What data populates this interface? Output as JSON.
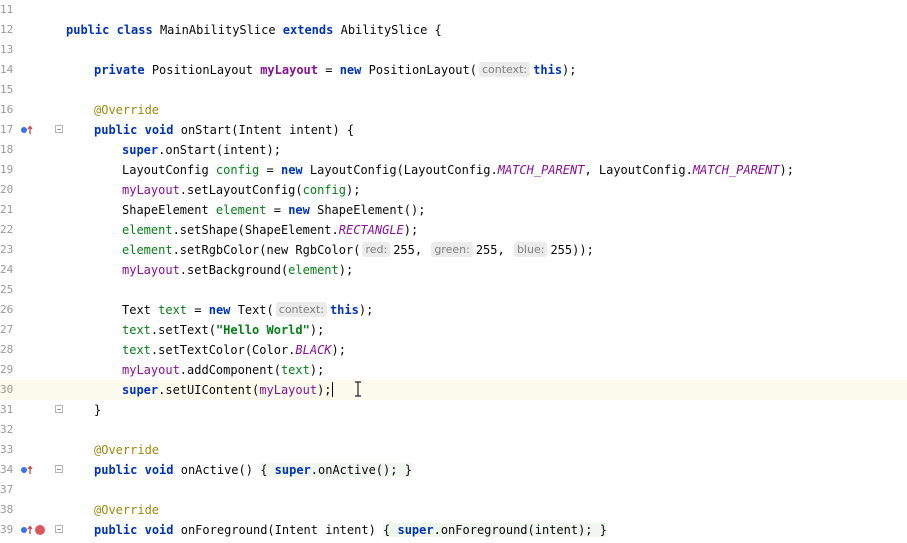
{
  "editor": {
    "lines": {
      "l11": {
        "num": "11"
      },
      "l12": {
        "num": "12",
        "kw_public": "public",
        "kw_class": "class",
        "class_name": "MainAbilitySlice",
        "kw_extends": "extends",
        "super_class": "AbilitySlice {"
      },
      "l13": {
        "num": "13"
      },
      "l14": {
        "num": "14",
        "kw_private": "private",
        "type": "PositionLayout",
        "field": "myLayout",
        "eq": " = ",
        "kw_new": "new",
        "ctor": " PositionLayout(",
        "hint": "context:",
        "kw_this": "this",
        "end": ");"
      },
      "l15": {
        "num": "15"
      },
      "l16": {
        "num": "16",
        "annotation": "@Override"
      },
      "l17": {
        "num": "17",
        "kw_public": "public",
        "kw_void": "void",
        "sig": " onStart(Intent ",
        "param": "intent",
        "end": ") {"
      },
      "l18": {
        "num": "18",
        "kw_super": "super",
        "call": ".onStart(",
        "param": "intent",
        "end": ");"
      },
      "l19": {
        "num": "19",
        "type": "LayoutConfig ",
        "var": "config",
        "eq": " = ",
        "kw_new": "new",
        "ctor": " LayoutConfig(LayoutConfig.",
        "const1": "MATCH_PARENT",
        "mid": ", LayoutConfig.",
        "const2": "MATCH_PARENT",
        "end": ");"
      },
      "l20": {
        "num": "20",
        "field": "myLayout",
        "call": ".setLayoutConfig(",
        "var": "config",
        "end": ");"
      },
      "l21": {
        "num": "21",
        "type": "ShapeElement ",
        "var": "element",
        "eq": " = ",
        "kw_new": "new",
        "ctor": " ShapeElement();"
      },
      "l22": {
        "num": "22",
        "var": "element",
        "call": ".setShape(ShapeElement.",
        "const": "RECTANGLE",
        "end": ");"
      },
      "l23": {
        "num": "23",
        "var": "element",
        "call": ".setRgbColor(",
        "kw_new": "new",
        "ctor": " RgbColor(",
        "hint_red": "red:",
        "red": "255",
        "sep1": ", ",
        "hint_green": "green:",
        "green": "255",
        "sep2": ", ",
        "hint_blue": "blue:",
        "blue": "255",
        "end": "));"
      },
      "l24": {
        "num": "24",
        "field": "myLayout",
        "call": ".setBackground(",
        "var": "element",
        "end": ");"
      },
      "l25": {
        "num": "25"
      },
      "l26": {
        "num": "26",
        "type": "Text ",
        "var": "text",
        "eq": " = ",
        "kw_new": "new",
        "ctor": " Text(",
        "hint": "context:",
        "kw_this": "this",
        "end": ");"
      },
      "l27": {
        "num": "27",
        "var": "text",
        "call": ".setText(",
        "string": "\"Hello World\"",
        "end": ");"
      },
      "l28": {
        "num": "28",
        "var": "text",
        "call": ".setTextColor(Color.",
        "const": "BLACK",
        "end": ");"
      },
      "l29": {
        "num": "29",
        "field": "myLayout",
        "call": ".addComponent(",
        "var": "text",
        "end": ");"
      },
      "l30": {
        "num": "30",
        "kw_super": "super",
        "call": ".setUIContent(",
        "field": "myLayout",
        "end": ");"
      },
      "l31": {
        "num": "31",
        "brace": "}"
      },
      "l33": {
        "num": "33"
      },
      "l34": {
        "num": "34",
        "kw_public": "public",
        "kw_void": "void",
        "sig": " onActive() ",
        "fold_open": "{ ",
        "kw_super": "super",
        "call": ".onActive(); ",
        "fold_close": "}"
      },
      "l37": {
        "num": "37"
      },
      "l38": {
        "num": "38",
        "annotation": "@Override"
      },
      "l39": {
        "num": "39",
        "kw_public": "public",
        "kw_void": "void",
        "sig": " onForeground(Intent intent) ",
        "fold_open": "{ ",
        "kw_super": "super",
        "call": ".onForeground(intent); ",
        "fold_close": "}"
      }
    },
    "l32_annotation": "@Override",
    "l32_num": "32"
  },
  "colors": {
    "keyword": "#0033b3",
    "annotation": "#9e880d",
    "field": "#871094",
    "local_variable": "#067d17",
    "number": "#1750eb",
    "current_line": "#fcfaed",
    "breakpoint": "#db5860",
    "override_marker": "#3574f0"
  },
  "icons": {
    "implements_marker": "override-up-arrow-icon",
    "breakpoint": "breakpoint-icon",
    "fold": "fold-toggle-icon",
    "text_cursor": "i-beam-cursor-icon"
  }
}
